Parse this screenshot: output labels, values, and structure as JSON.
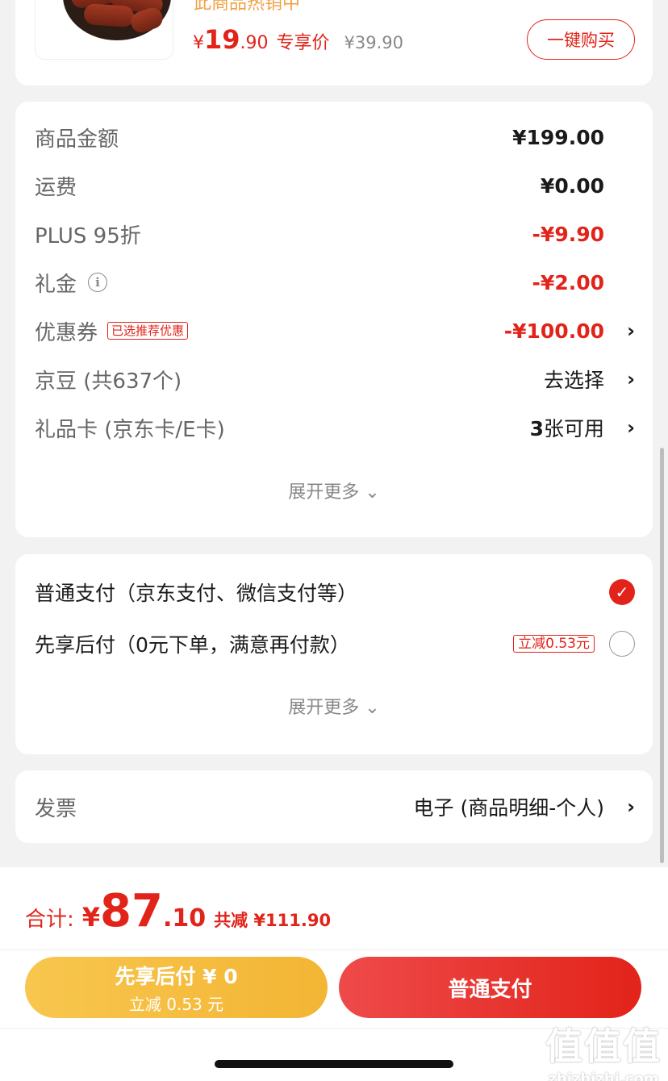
{
  "product": {
    "status_text": "此商品热销中",
    "price_symbol": "¥",
    "price_int": "19",
    "price_dec": ".90",
    "exclusive_label": "专享价",
    "original_price": "¥39.90",
    "buy_button": "一键购买"
  },
  "summary": {
    "rows": [
      {
        "label": "商品金额",
        "value": "¥199.00"
      },
      {
        "label": "运费",
        "value": "¥0.00"
      },
      {
        "label": "PLUS 95折",
        "value": "-¥9.90"
      },
      {
        "label": "礼金",
        "value": "-¥2.00"
      },
      {
        "label": "优惠券",
        "tag": "已选推荐优惠",
        "value": "-¥100.00"
      },
      {
        "label": "京豆 (共637个)",
        "value": "去选择"
      },
      {
        "label": "礼品卡 (京东卡/E卡)",
        "value_bold": "3",
        "value": "张可用"
      }
    ],
    "expand_more": "展开更多 ⌄"
  },
  "payment": {
    "options": [
      {
        "label": "普通支付（京东支付、微信支付等）",
        "selected": true
      },
      {
        "label": "先享后付（0元下单，满意再付款）",
        "tag": "立减0.53元",
        "selected": false
      }
    ],
    "expand_more": "展开更多 ⌄"
  },
  "invoice": {
    "label": "发票",
    "value": "电子 (商品明细-个人)"
  },
  "bottom": {
    "total_label": "合计:",
    "total_symbol": "¥",
    "total_int": "87",
    "total_dec": ".10",
    "total_discount": "共减 ¥111.90",
    "later_button_line1": "先享后付 ¥ 0",
    "later_button_line2": "立减 0.53 元",
    "pay_button": "普通支付"
  },
  "watermark": {
    "big": "值值值",
    "small": "zhizhizhi.com"
  },
  "colors": {
    "accent_red": "#e2231a",
    "gold": "#f3b534",
    "background": "#f2f2f2"
  }
}
